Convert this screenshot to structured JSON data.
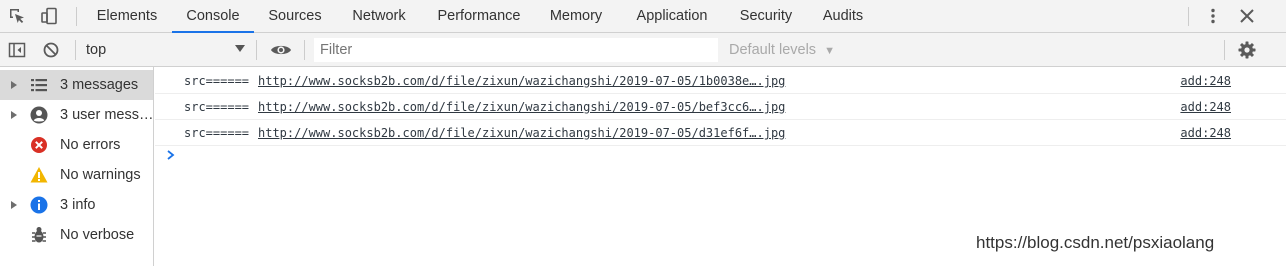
{
  "tabs": [
    {
      "label": "Elements"
    },
    {
      "label": "Console",
      "active": true
    },
    {
      "label": "Sources"
    },
    {
      "label": "Network"
    },
    {
      "label": "Performance"
    },
    {
      "label": "Memory"
    },
    {
      "label": "Application"
    },
    {
      "label": "Security"
    },
    {
      "label": "Audits"
    }
  ],
  "toolbar": {
    "context": "top",
    "filter_placeholder": "Filter",
    "levels": "Default levels"
  },
  "sidebar": {
    "items": [
      {
        "label": "3 messages",
        "icon": "list-icon",
        "expandable": true,
        "selected": true
      },
      {
        "label": "3 user mess…",
        "icon": "user-icon",
        "expandable": true
      },
      {
        "label": "No errors",
        "icon": "error-icon"
      },
      {
        "label": "No warnings",
        "icon": "warning-icon"
      },
      {
        "label": "3 info",
        "icon": "info-icon",
        "expandable": true
      },
      {
        "label": "No verbose",
        "icon": "bug-icon"
      }
    ]
  },
  "messages": [
    {
      "prefix": "src======",
      "link": "http://www.socksb2b.com/d/file/zixun/wazichangshi/2019-07-05/1b0038e….jpg",
      "source": "add:248"
    },
    {
      "prefix": "src======",
      "link": "http://www.socksb2b.com/d/file/zixun/wazichangshi/2019-07-05/bef3cc6….jpg",
      "source": "add:248"
    },
    {
      "prefix": "src======",
      "link": "http://www.socksb2b.com/d/file/zixun/wazichangshi/2019-07-05/d31ef6f….jpg",
      "source": "add:248"
    }
  ],
  "watermark": "https://blog.csdn.net/psxiaolang",
  "colors": {
    "accent": "#1a73e8",
    "error": "#d93025",
    "warning": "#f2b600",
    "info": "#1a73e8"
  }
}
